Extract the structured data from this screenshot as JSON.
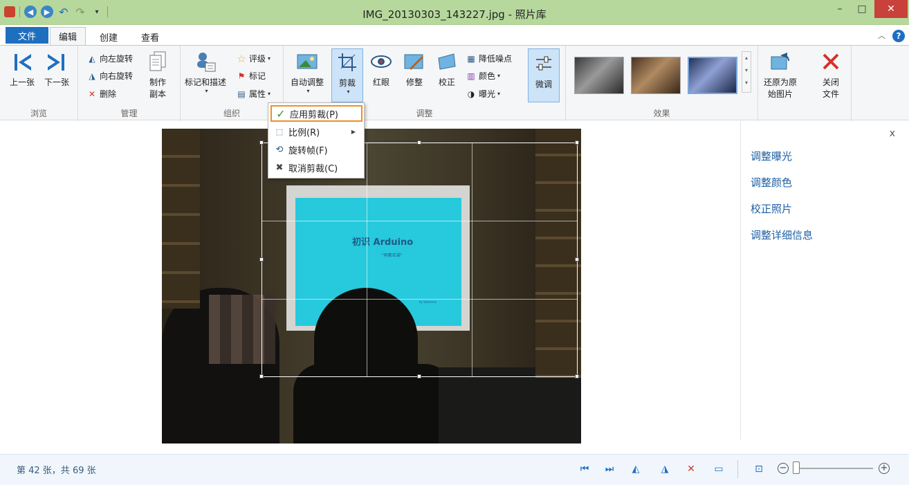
{
  "window": {
    "title": "IMG_20130303_143227.jpg - 照片库",
    "min": "–",
    "max": "□",
    "close": "✕"
  },
  "tabs": {
    "file": "文件",
    "edit": "编辑",
    "create": "创建",
    "view": "查看"
  },
  "ribbon": {
    "browse": {
      "label": "浏览",
      "prev": "上一张",
      "next": "下一张"
    },
    "manage": {
      "label": "管理",
      "rotate_left": "向左旋转",
      "rotate_right": "向右旋转",
      "delete": "删除",
      "make_copy_line1": "制作",
      "make_copy_line2": "副本"
    },
    "organize": {
      "label": "组织",
      "tag": "标记和描述",
      "rating": "评级",
      "flag": "标记",
      "properties": "属性"
    },
    "adjust": {
      "label": "调整",
      "auto_adjust": "自动调整",
      "crop": "剪裁",
      "red_eye": "红眼",
      "retouch": "修整",
      "straighten": "校正",
      "noise": "降低噪点",
      "color": "颜色",
      "exposure": "曝光",
      "fine_tune": "微调"
    },
    "effects": {
      "label": "效果"
    },
    "revert_line1": "还原为原",
    "revert_line2": "始图片",
    "close_line1": "关闭",
    "close_line2": "文件"
  },
  "crop_menu": {
    "apply": "应用剪裁(P)",
    "ratio": "比例(R)",
    "rotate_frame": "旋转帧(F)",
    "cancel": "取消剪裁(C)"
  },
  "photo": {
    "slide_title": "初识 Arduino",
    "slide_sub": "\"阿都衣诺\"",
    "slide_author": "by Someone"
  },
  "side_panel": {
    "close": "x",
    "links": [
      "调整曝光",
      "调整颜色",
      "校正照片",
      "调整详细信息"
    ]
  },
  "status": {
    "count": "第 42 张，共 69 张"
  }
}
